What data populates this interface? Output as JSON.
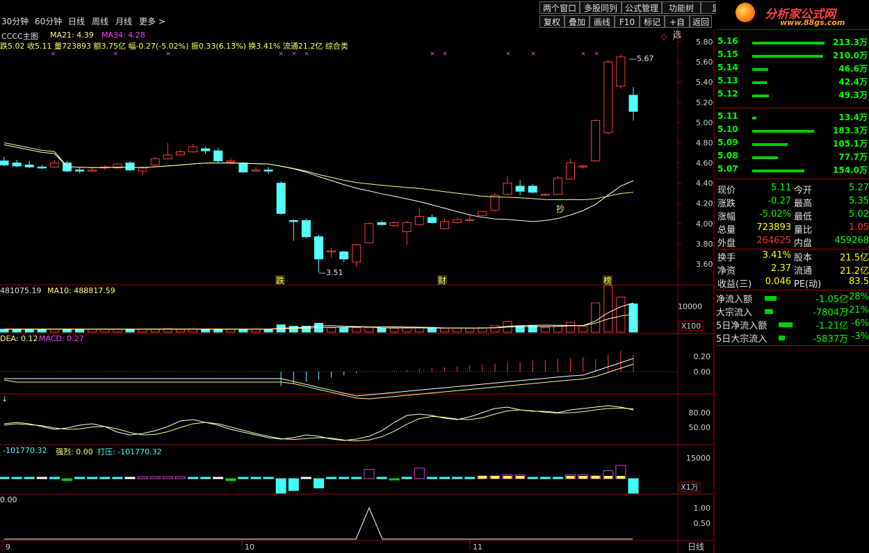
{
  "toolbar": {
    "periods": [
      "30分钟",
      "60分钟",
      "日线",
      "周线",
      "月线",
      "更多 >"
    ],
    "top_buttons": [
      "两个窗口",
      "多股同列",
      "公式管理",
      "功能树",
      "显隐"
    ],
    "sub_buttons": [
      "复权",
      "叠加",
      "画线",
      "F10",
      "标记",
      "+自选",
      "返回"
    ]
  },
  "logo": {
    "text": "分析家公式网",
    "url": "www.88gs.com"
  },
  "main_panel": {
    "title": "CCCC主图",
    "ma21": "MA21: 4.39",
    "ma34": "MA34: 4.28",
    "info_line": "跌5.02 收5.11 量723893 额3.75亿 幅-0.27(-5.02%) 振0.33(6.13%) 换3.41% 流通21.2亿 综合类",
    "yticks": [
      "5.80",
      "5.60",
      "5.40",
      "5.20",
      "5.00",
      "4.80",
      "4.60",
      "4.40",
      "4.20",
      "4.00",
      "3.80",
      "3.60"
    ],
    "high_label": "5.67",
    "low_label": "3.51",
    "signals": [
      "跌",
      "财",
      "榜"
    ],
    "chao_label": "抄"
  },
  "volume_panel": {
    "legend_a": "481075.19",
    "legend_b": "MA10: 488817.59",
    "ytick": "10000",
    "unit": "X100"
  },
  "macd_panel": {
    "legend_a": "DEA: 0.12",
    "legend_b": "MACD: 0.27",
    "yticks": [
      "0.20",
      "0.00"
    ]
  },
  "kdj_panel": {
    "yticks": [
      "80.00",
      "50.00"
    ]
  },
  "force_panel": {
    "legend_a": "-101770.32",
    "legend_b": "强烈: 0.00",
    "legend_c": "打压: -101770.32",
    "ytick": "15000",
    "unit": "X1万"
  },
  "bottom_panel": {
    "legend": "0.00",
    "yticks": [
      "1.00",
      "0.50"
    ]
  },
  "date_axis": {
    "labels": [
      "9",
      "10",
      "11"
    ],
    "mode_label": "日线"
  },
  "orderbook": {
    "asks": [
      {
        "price": "5.16",
        "vol": "213.3万",
        "frac": 1.0
      },
      {
        "price": "5.15",
        "vol": "210.0万",
        "frac": 0.985
      },
      {
        "price": "5.14",
        "vol": "46.6万",
        "frac": 0.22
      },
      {
        "price": "5.13",
        "vol": "42.4万",
        "frac": 0.2
      },
      {
        "price": "5.12",
        "vol": "49.3万",
        "frac": 0.23
      }
    ],
    "bids": [
      {
        "price": "5.11",
        "vol": "13.4万",
        "frac": 0.06
      },
      {
        "price": "5.10",
        "vol": "183.3万",
        "frac": 0.86
      },
      {
        "price": "5.09",
        "vol": "105.1万",
        "frac": 0.49
      },
      {
        "price": "5.08",
        "vol": "77.7万",
        "frac": 0.36
      },
      {
        "price": "5.07",
        "vol": "154.0万",
        "frac": 0.72
      }
    ]
  },
  "quote": [
    {
      "l1": "现价",
      "v1": "5.11",
      "l2": "今开",
      "v2": "5.27",
      "c2": "#00ff00"
    },
    {
      "l1": "涨跌",
      "v1": "-0.27",
      "l2": "最高",
      "v2": "5.35",
      "c2": "#00ff00"
    },
    {
      "l1": "涨幅",
      "v1": "-5.02%",
      "l2": "最低",
      "v2": "5.02",
      "c2": "#00ff00"
    },
    {
      "l1": "总量",
      "v1": "723893",
      "l2": "量比",
      "v2": "1.05",
      "c2": "#ff3030",
      "c1": "#ffff00"
    },
    {
      "l1": "外盘",
      "v1": "264625",
      "l2": "内盘",
      "v2": "459268",
      "c2": "#00ff00",
      "c1": "#ff3030"
    },
    {
      "l1": "换手",
      "v1": "3.41%",
      "l2": "股本",
      "v2": "21.5亿",
      "c2": "#ffff00",
      "c1": "#ffff00"
    },
    {
      "l1": "净资",
      "v1": "2.37",
      "l2": "流通",
      "v2": "21.2亿",
      "c2": "#ffff00",
      "c1": "#ffff00"
    },
    {
      "l1": "收益(三)",
      "v1": "0.046",
      "l2": "PE(动)",
      "v2": "83.5",
      "c2": "#ffff00",
      "c1": "#ffff00"
    }
  ],
  "flow": [
    {
      "label": "净流入额",
      "val": "-1.05亿",
      "pct": "-28%",
      "frac": 0.55
    },
    {
      "label": "大宗流入",
      "val": "-7804万",
      "pct": "-21%",
      "frac": 0.4
    },
    {
      "label": "5日净流入额",
      "val": "-1.21亿",
      "pct": "-6%",
      "frac": 0.65
    },
    {
      "label": "5日大宗流入",
      "val": "-5837万",
      "pct": "-3%",
      "frac": 0.3
    }
  ],
  "chart_data": {
    "type": "candlestick",
    "candles": [
      [
        4.62,
        4.66,
        4.57,
        4.58
      ],
      [
        4.6,
        4.63,
        4.56,
        4.57
      ],
      [
        4.58,
        4.62,
        4.55,
        4.56
      ],
      [
        4.56,
        4.58,
        4.54,
        4.55
      ],
      [
        4.56,
        4.62,
        4.55,
        4.6
      ],
      [
        4.6,
        4.62,
        4.51,
        4.52
      ],
      [
        4.53,
        4.55,
        4.5,
        4.52
      ],
      [
        4.52,
        4.55,
        4.51,
        4.53
      ],
      [
        4.55,
        4.58,
        4.53,
        4.56
      ],
      [
        4.55,
        4.6,
        4.54,
        4.59
      ],
      [
        4.6,
        4.62,
        4.52,
        4.53
      ],
      [
        4.52,
        4.57,
        4.48,
        4.55
      ],
      [
        4.58,
        4.66,
        4.57,
        4.64
      ],
      [
        4.64,
        4.8,
        4.63,
        4.68
      ],
      [
        4.68,
        4.73,
        4.67,
        4.71
      ],
      [
        4.71,
        4.79,
        4.7,
        4.76
      ],
      [
        4.74,
        4.76,
        4.69,
        4.72
      ],
      [
        4.72,
        4.75,
        4.6,
        4.62
      ],
      [
        4.62,
        4.65,
        4.58,
        4.62
      ],
      [
        4.6,
        4.61,
        4.5,
        4.51
      ],
      [
        4.52,
        4.56,
        4.51,
        4.53
      ],
      [
        4.53,
        4.56,
        4.49,
        4.52
      ],
      [
        4.4,
        4.42,
        4.09,
        4.1
      ],
      [
        4.03,
        4.04,
        3.83,
        4.02
      ],
      [
        4.03,
        4.05,
        3.85,
        3.87
      ],
      [
        3.87,
        3.89,
        3.52,
        3.65
      ],
      [
        3.73,
        3.76,
        3.66,
        3.73
      ],
      [
        3.72,
        3.73,
        3.62,
        3.65
      ],
      [
        3.62,
        3.8,
        3.57,
        3.79
      ],
      [
        3.81,
        4.01,
        3.8,
        4.0
      ],
      [
        4.01,
        4.03,
        3.98,
        3.99
      ],
      [
        3.98,
        4.02,
        3.97,
        4.01
      ],
      [
        3.92,
        4.03,
        3.79,
        4.01
      ],
      [
        3.99,
        4.16,
        3.98,
        4.07
      ],
      [
        4.06,
        4.09,
        4.0,
        4.01
      ],
      [
        3.95,
        4.05,
        3.94,
        4.02
      ],
      [
        4.01,
        4.06,
        4.0,
        4.04
      ],
      [
        4.04,
        4.08,
        4.02,
        4.04
      ],
      [
        4.08,
        4.13,
        4.07,
        4.12
      ],
      [
        4.13,
        4.3,
        4.12,
        4.28
      ],
      [
        4.29,
        4.47,
        4.28,
        4.4
      ],
      [
        4.37,
        4.43,
        4.28,
        4.32
      ],
      [
        4.37,
        4.39,
        4.3,
        4.31
      ],
      [
        4.28,
        4.3,
        4.27,
        4.29
      ],
      [
        4.29,
        4.47,
        4.28,
        4.45
      ],
      [
        4.44,
        4.64,
        4.43,
        4.6
      ],
      [
        4.56,
        4.58,
        4.54,
        4.57
      ],
      [
        4.62,
        5.03,
        4.61,
        5.02
      ],
      [
        4.9,
        5.62,
        4.88,
        5.6
      ],
      [
        5.36,
        5.67,
        5.33,
        5.65
      ],
      [
        5.27,
        5.35,
        5.02,
        5.11
      ]
    ],
    "volume": [
      0.3,
      0.3,
      0.3,
      0.3,
      0.3,
      0.3,
      0.3,
      0.3,
      0.3,
      0.3,
      0.3,
      0.3,
      0.3,
      0.35,
      0.3,
      0.3,
      0.3,
      0.3,
      0.3,
      0.3,
      0.3,
      0.3,
      0.75,
      0.6,
      0.6,
      0.9,
      0.45,
      0.45,
      0.45,
      0.45,
      0.4,
      0.4,
      0.45,
      0.45,
      0.4,
      0.4,
      0.4,
      0.4,
      0.45,
      0.65,
      1.1,
      0.65,
      0.65,
      0.5,
      0.6,
      1.0,
      0.6,
      3.0,
      4.8,
      3.6,
      2.9
    ]
  }
}
